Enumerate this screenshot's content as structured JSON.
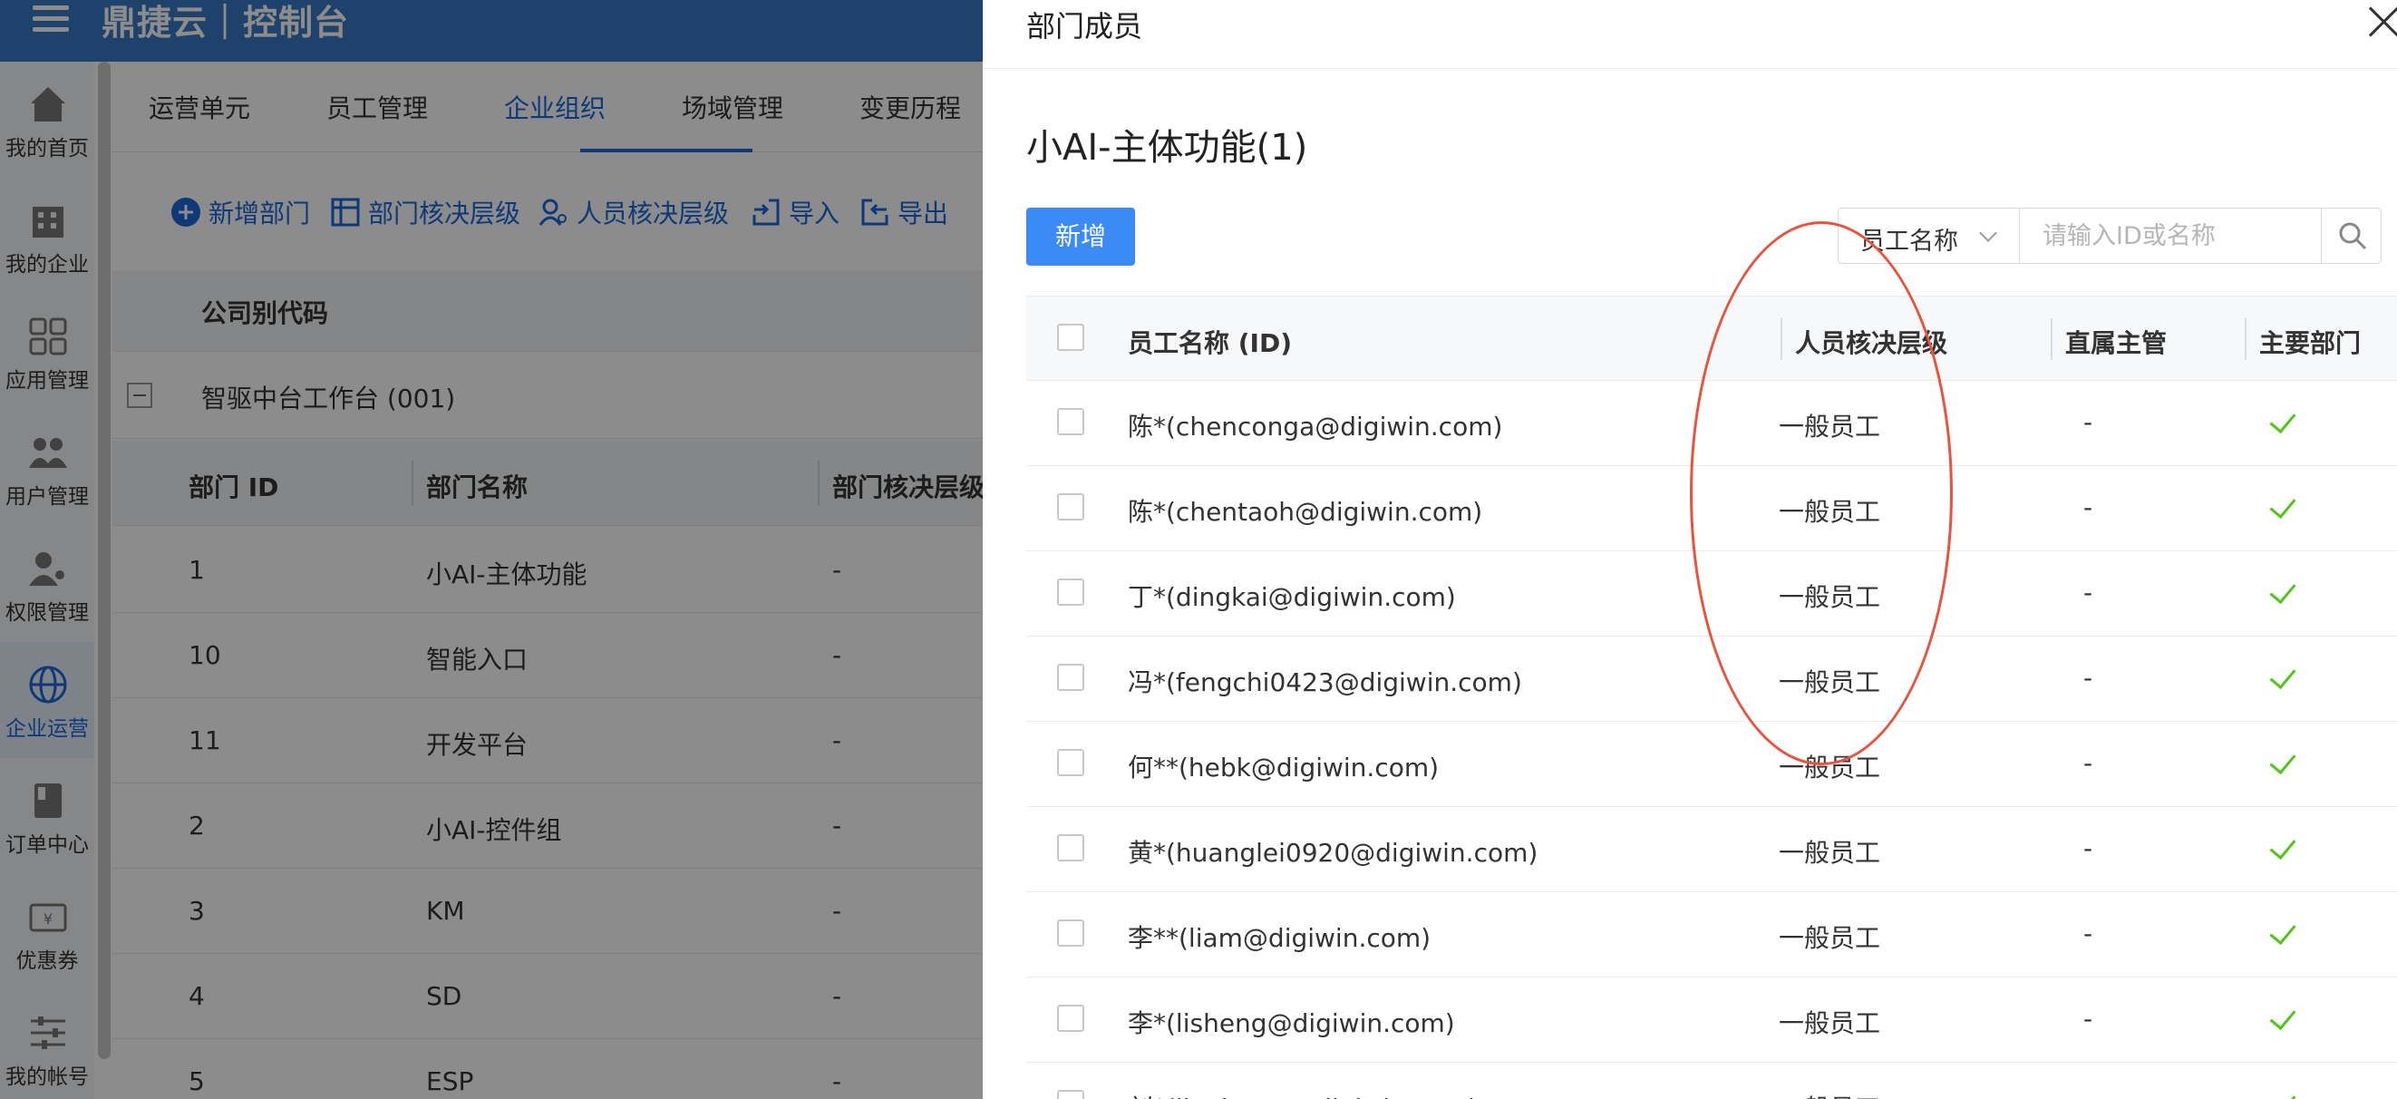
{
  "app": {
    "title": "鼎捷云｜控制台"
  },
  "sidebar": {
    "items": [
      {
        "label": "我的首页",
        "icon": "home-icon"
      },
      {
        "label": "我的企业",
        "icon": "building-icon"
      },
      {
        "label": "应用管理",
        "icon": "grid-icon"
      },
      {
        "label": "用户管理",
        "icon": "users-icon"
      },
      {
        "label": "权限管理",
        "icon": "user-key-icon"
      },
      {
        "label": "企业运营",
        "icon": "globe-icon",
        "active": true
      },
      {
        "label": "订单中心",
        "icon": "book-icon"
      },
      {
        "label": "优惠券",
        "icon": "coupon-icon"
      },
      {
        "label": "我的帐号",
        "icon": "sliders-icon"
      }
    ]
  },
  "tabs": [
    {
      "label": "运营单元"
    },
    {
      "label": "员工管理"
    },
    {
      "label": "企业组织",
      "active": true
    },
    {
      "label": "场域管理"
    },
    {
      "label": "变更历程"
    }
  ],
  "toolbar": {
    "add_dept": "新增部门",
    "dept_level": "部门核决层级",
    "person_level": "人员核决层级",
    "import": "导入",
    "export": "导出"
  },
  "company": {
    "alias_header": "公司别代码",
    "tree_node": "智驱中台工作台 (001)"
  },
  "dept_table": {
    "headers": {
      "id": "部门 ID",
      "name": "部门名称",
      "level": "部门核决层级"
    },
    "rows": [
      {
        "id": "1",
        "name": "小AI-主体功能",
        "level": "-"
      },
      {
        "id": "10",
        "name": "智能入口",
        "level": "-"
      },
      {
        "id": "11",
        "name": "开发平台",
        "level": "-"
      },
      {
        "id": "2",
        "name": "小AI-控件组",
        "level": "-"
      },
      {
        "id": "3",
        "name": "KM",
        "level": "-"
      },
      {
        "id": "4",
        "name": "SD",
        "level": "-"
      },
      {
        "id": "5",
        "name": "ESP",
        "level": "-"
      }
    ]
  },
  "drawer": {
    "title": "部门成员",
    "dept_name": "小AI-主体功能(1)",
    "add_label": "新增",
    "search": {
      "field": "员工名称",
      "placeholder": "请输入ID或名称"
    },
    "headers": {
      "name": "员工名称 (ID)",
      "level": "人员核决层级",
      "manager": "直属主管",
      "primary": "主要部门"
    },
    "rows": [
      {
        "name": "陈*(chenconga@digiwin.com)",
        "level": "一般员工",
        "manager": "-",
        "primary": true
      },
      {
        "name": "陈*(chentaoh@digiwin.com)",
        "level": "一般员工",
        "manager": "-",
        "primary": true
      },
      {
        "name": "丁*(dingkai@digiwin.com)",
        "level": "一般员工",
        "manager": "-",
        "primary": true
      },
      {
        "name": "冯*(fengchi0423@digiwin.com)",
        "level": "一般员工",
        "manager": "-",
        "primary": true
      },
      {
        "name": "何**(hebk@digiwin.com)",
        "level": "一般员工",
        "manager": "-",
        "primary": true
      },
      {
        "name": "黄*(huanglei0920@digiwin.com)",
        "level": "一般员工",
        "manager": "-",
        "primary": true
      },
      {
        "name": "李**(liam@digiwin.com)",
        "level": "一般员工",
        "manager": "-",
        "primary": true
      },
      {
        "name": "李*(lisheng@digiwin.com)",
        "level": "一般员工",
        "manager": "-",
        "primary": true
      },
      {
        "name": "刘*(liuxiaoyu@digiwin.com)",
        "level": "一般员工",
        "manager": "-",
        "primary": true
      }
    ]
  },
  "colors": {
    "brand": "#3a78c7",
    "primary_button": "#3b8af5",
    "check": "#52c41a",
    "annotation": "#e8533f"
  }
}
